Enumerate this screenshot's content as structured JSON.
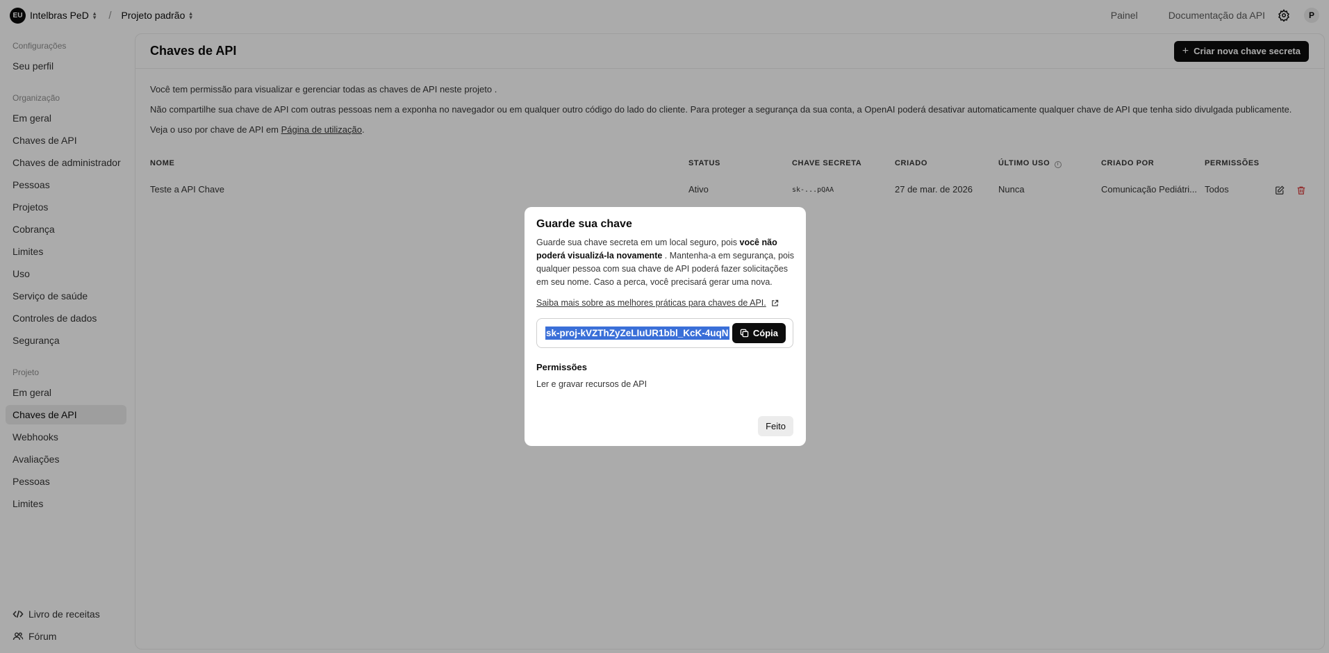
{
  "topbar": {
    "org_initials": "EU",
    "org_name": "Intelbras PeD",
    "separator": "/",
    "project_name": "Projeto padrão",
    "links": [
      "Painel",
      "Documentação da API"
    ],
    "user_initial": "P"
  },
  "sidebar": {
    "sections": [
      {
        "title": "Configurações",
        "items": [
          "Seu perfil"
        ]
      },
      {
        "title": "Organização",
        "items": [
          "Em geral",
          "Chaves de API",
          "Chaves de administrador",
          "Pessoas",
          "Projetos",
          "Cobrança",
          "Limites",
          "Uso",
          "Serviço de saúde",
          "Controles de dados",
          "Segurança"
        ]
      },
      {
        "title": "Projeto",
        "items": [
          "Em geral",
          "Chaves de API",
          "Webhooks",
          "Avaliações",
          "Pessoas",
          "Limites"
        ]
      }
    ],
    "active": "Chaves de API",
    "footer": {
      "cookbook": "Livro de receitas",
      "forum": "Fórum"
    }
  },
  "main": {
    "title": "Chaves de API",
    "create_button": "Criar nova chave secreta",
    "para1": "Você tem permissão para visualizar e gerenciar todas as chaves de API neste projeto .",
    "para2": "Não compartilhe sua chave de API com outras pessoas nem a exponha no navegador ou em qualquer outro código do lado do cliente. Para proteger a segurança da sua conta, a OpenAI poderá desativar automaticamente qualquer chave de API que tenha sido divulgada publicamente.",
    "para3_prefix": "Veja o uso por chave de API em ",
    "para3_link": "Página de utilização",
    "para3_suffix": ".",
    "table": {
      "headers": {
        "name": "NOME",
        "status": "STATUS",
        "secret": "CHAVE SECRETA",
        "created": "CRIADO",
        "last_used": "ÚLTIMO USO",
        "created_by": "CRIADO POR",
        "permissions": "PERMISSÕES"
      },
      "rows": [
        {
          "name": "Teste a API Chave",
          "status": "Ativo",
          "secret": "sk-...pQAA",
          "created": "27 de mar. de 2026",
          "last_used": "Nunca",
          "created_by": "Comunicação Pediátri...",
          "permissions": "Todos"
        }
      ]
    }
  },
  "modal": {
    "title": "Guarde sua chave",
    "desc_1": "Guarde sua chave secreta em um local seguro, pois ",
    "desc_bold": "você não poderá visualizá-la novamente",
    "desc_2": " . Mantenha-a em segurança, pois qualquer pessoa com sua chave de API poderá fazer solicitações em seu nome. Caso a perca, você precisará gerar uma nova.",
    "link": "Saiba mais sobre as melhores práticas para chaves de API.",
    "key": "sk-proj-kVZThZyZeLIuUR1bbl_KcK-4uqN",
    "copy": "Cópia",
    "permissions_label": "Permissões",
    "permissions_value": "Ler e gravar recursos de API",
    "done": "Feito"
  }
}
